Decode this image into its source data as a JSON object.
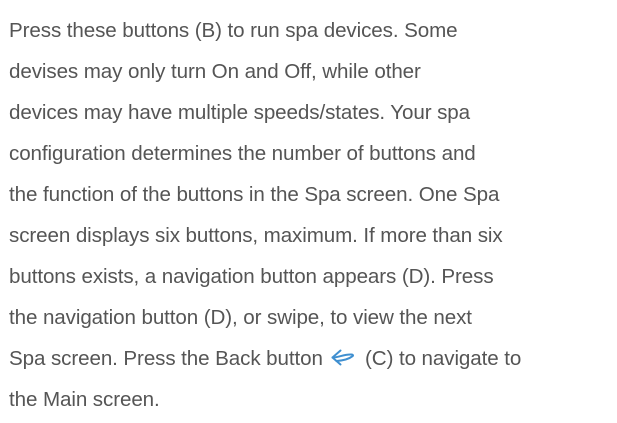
{
  "document": {
    "lines": [
      "Press these buttons (B) to run spa devices. Some",
      "devises may only turn On and Off, while other",
      "devices may have multiple speeds/states. Your spa",
      "configuration determines the number of buttons and",
      "the function of the buttons in the Spa screen. One Spa",
      "screen displays six buttons, maximum. If more than six",
      "buttons exists, a navigation button appears (D). Press",
      "the navigation button (D), or swipe, to view the next"
    ],
    "line9_before_icon": "Spa screen. Press the Back button",
    "line9_after_icon": "(C) to navigate to",
    "line10": "the Main screen."
  },
  "icons": {
    "back_icon": "back-arrow-icon",
    "back_icon_color": "#3f8fd0"
  },
  "colors": {
    "text": "#555555",
    "background": "#ffffff"
  }
}
